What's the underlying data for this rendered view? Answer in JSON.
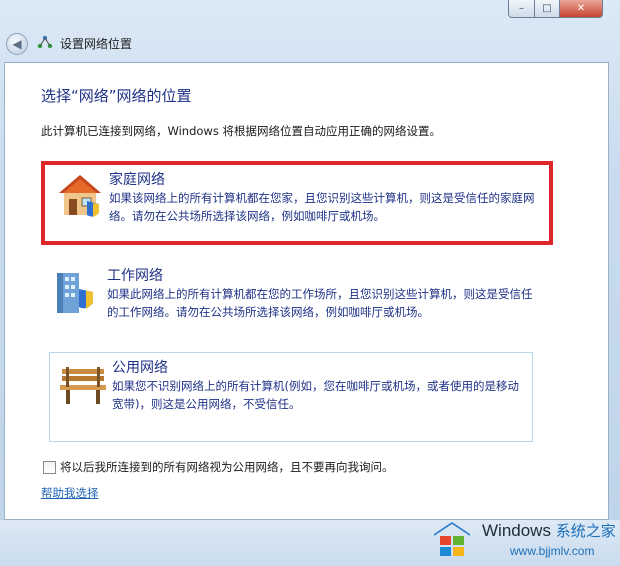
{
  "window": {
    "title": "设置网络位置",
    "min_symbol": "–",
    "max_symbol": "□",
    "close_symbol": "✕",
    "back_symbol": "◀"
  },
  "main": {
    "heading": "选择“网络”网络的位置",
    "description": "此计算机已连接到网络，Windows 将根据网络位置自动应用正确的网络设置。"
  },
  "options": {
    "home": {
      "title": "家庭网络",
      "desc": "如果该网络上的所有计算机都在您家，且您识别这些计算机，则这是受信任的家庭网络。请勿在公共场所选择该网络，例如咖啡厅或机场。"
    },
    "work": {
      "title": "工作网络",
      "desc": "如果此网络上的所有计算机都在您的工作场所，且您识别这些计算机，则这是受信任的工作网络。请勿在公共场所选择该网络，例如咖啡厅或机场。"
    },
    "public": {
      "title": "公用网络",
      "desc": "如果您不识别网络上的所有计算机(例如，您在咖啡厅或机场，或者使用的是移动宽带)，则这是公用网络，不受信任。"
    }
  },
  "footer": {
    "checkbox_label": "将以后我所连接到的所有网络视为公用网络，且不要再向我询问。",
    "checkbox_checked": false,
    "help_link": "帮助我选择"
  },
  "watermark": {
    "brand": "Windows",
    "brand_cn": "系统之家",
    "url": "www.bjjmlv.com"
  },
  "colors": {
    "accent_text": "#1e3287",
    "highlight_border": "#e1262b",
    "link": "#1f63b5"
  }
}
